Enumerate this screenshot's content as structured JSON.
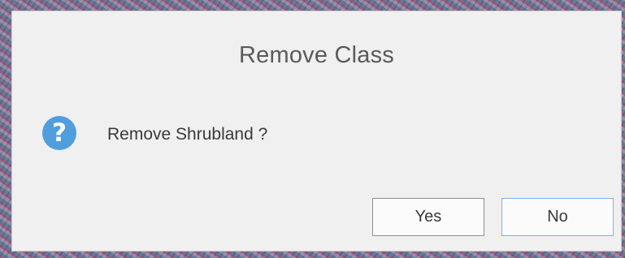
{
  "dialog": {
    "title": "Remove Class",
    "icon": "question-icon",
    "icon_glyph": "?",
    "message": "Remove Shrubland ?",
    "yes_label": "Yes",
    "no_label": "No"
  },
  "colors": {
    "dialog_background": "#f0f0f0",
    "icon_blue": "#4f9fde",
    "title_text": "#5a5a5a",
    "body_text": "#3a3a3a",
    "no_button_border": "#7fb3e0"
  }
}
